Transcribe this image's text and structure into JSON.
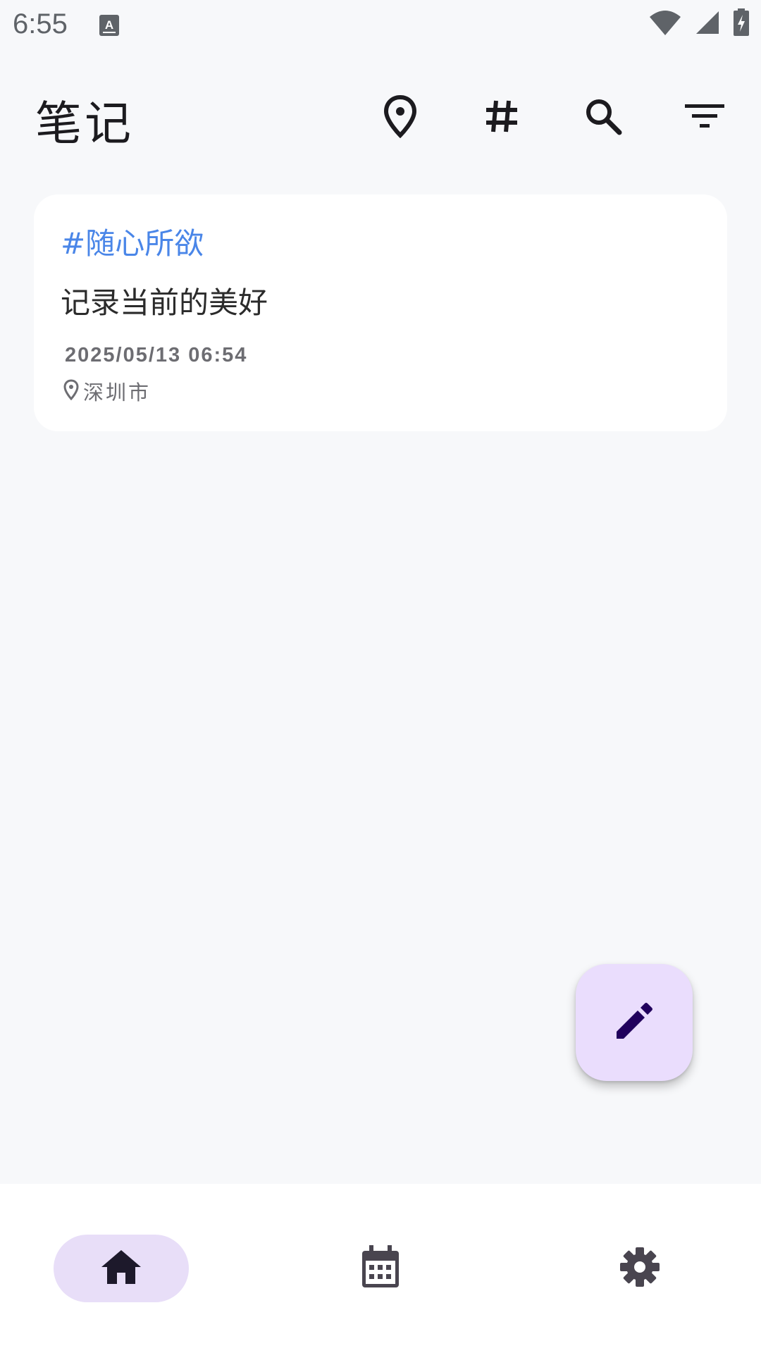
{
  "status_bar": {
    "time": "6:55"
  },
  "app_bar": {
    "title": "笔记",
    "actions": [
      {
        "name": "location-icon"
      },
      {
        "name": "tag-icon"
      },
      {
        "name": "search-icon"
      },
      {
        "name": "filter-icon"
      }
    ]
  },
  "notes": [
    {
      "tag": "#随心所欲",
      "content": "记录当前的美好",
      "timestamp": "2025/05/13 06:54",
      "location": "深圳市"
    }
  ],
  "fab": {
    "icon": "edit-icon"
  },
  "bottom_nav": {
    "items": [
      {
        "icon": "home-icon",
        "selected": true
      },
      {
        "icon": "calendar-icon",
        "selected": false
      },
      {
        "icon": "settings-icon",
        "selected": false
      }
    ]
  },
  "colors": {
    "background": "#f7f8fa",
    "tag": "#4a86e8",
    "fab": "#eaddfd",
    "nav_selected": "#e8def8"
  }
}
